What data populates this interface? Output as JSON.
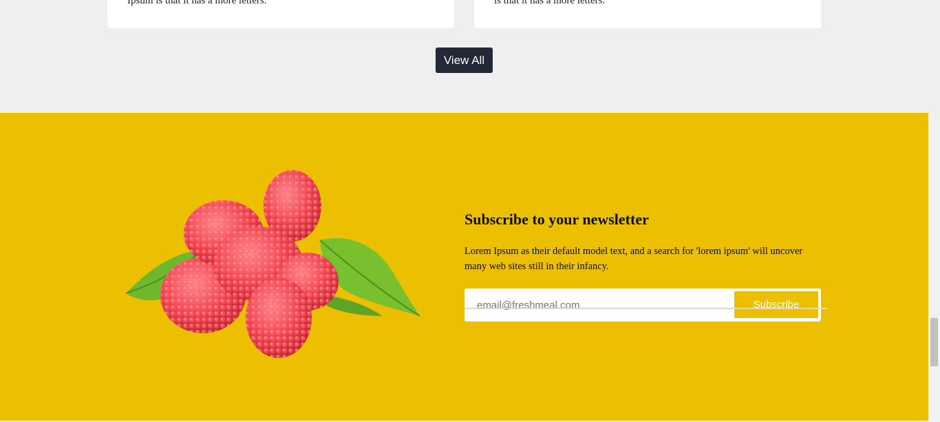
{
  "cards": [
    {
      "text": "Ipsum is that it has a more letters."
    },
    {
      "text": "is that it has a more letters."
    }
  ],
  "view_all_label": "View All",
  "newsletter": {
    "title": "Subscribe to your newsletter",
    "description": "Lorem Ipsum as their default model text, and a search for 'lorem ipsum' will uncover many web sites still in their infancy.",
    "email_placeholder": "email@freshmeal.com",
    "subscribe_label": "Subscribe",
    "image": "raspberries-with-leaves"
  },
  "colors": {
    "background": "#efefef",
    "newsletter_bg": "#ecbf00",
    "button_dark": "#232936",
    "subscribe_bg": "#ecbf00"
  }
}
